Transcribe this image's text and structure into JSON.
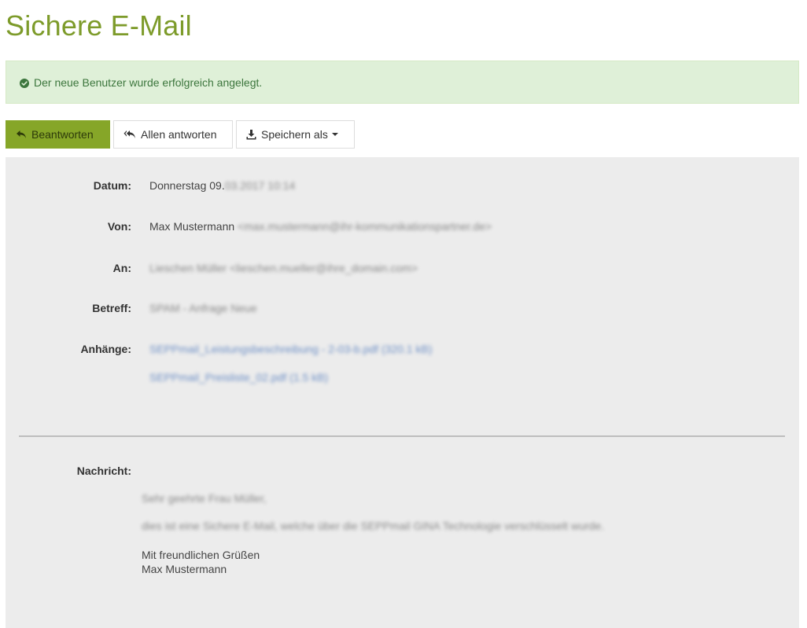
{
  "page": {
    "title": "Sichere E-Mail"
  },
  "alert": {
    "message": "Der neue Benutzer wurde erfolgreich angelegt.",
    "color": "#3c763d"
  },
  "toolbar": {
    "reply_label": "Beantworten",
    "reply_all_label": "Allen antworten",
    "save_as_label": "Speichern als"
  },
  "email": {
    "date_label": "Datum:",
    "date_value": "Donnerstag 09.",
    "date_value_obscured": "03.2017 10:14",
    "from_label": "Von:",
    "from_value": "Max Mustermann",
    "from_value_obscured": "<max.mustermann@ihr-kommunikationspartner.de>",
    "to_label": "An:",
    "to_value_obscured": "Lieschen Müller <lieschen.mueller@ihre_domain.com>",
    "subject_label": "Betreff:",
    "subject_value_obscured": "SPAM - Anfrage Neue",
    "attachments_label": "Anhänge:",
    "attachments": [
      "SEPPmail_Leistungsbeschreibung - 2-03-b.pdf (320.1 kB)",
      "SEPPmail_Preisliste_02.pdf (1.5 kB)"
    ],
    "message_label": "Nachricht:",
    "message_lines_obscured": [
      "Sehr geehrte Frau Müller,",
      "dies ist eine Sichere E-Mail, welche über die SEPPmail GINA Technologie verschlüsselt wurde."
    ],
    "closing": "Mit freundlichen Grüßen",
    "signature": "Max Mustermann"
  },
  "colors": {
    "title": "#7d9b2a",
    "primary_button": "#86a628",
    "alert_background": "#dff0d8",
    "panel_background": "#ececec"
  }
}
